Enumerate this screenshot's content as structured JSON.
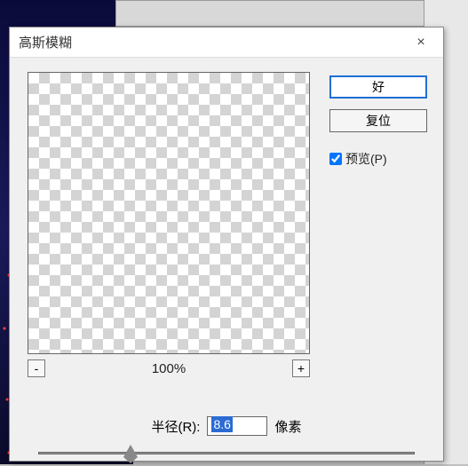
{
  "dialog": {
    "title": "高斯模糊",
    "close_label": "×"
  },
  "buttons": {
    "ok": "好",
    "reset": "复位"
  },
  "preview": {
    "checkbox_label": "预览(P)",
    "checked": true
  },
  "zoom": {
    "minus": "-",
    "plus": "+",
    "level": "100%"
  },
  "radius": {
    "label": "半径(R):",
    "value": "8.6",
    "unit": "像素"
  }
}
